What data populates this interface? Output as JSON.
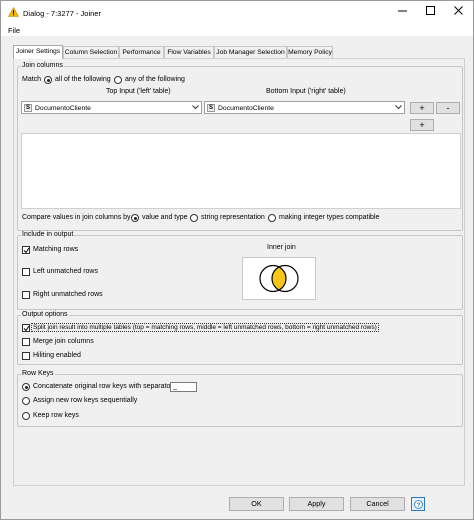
{
  "window": {
    "title": "Dialog - 7:3277 - Joiner",
    "controls": [
      "minimize-icon",
      "maximize-icon",
      "close-icon"
    ]
  },
  "menu": {
    "file": "File"
  },
  "tabs": [
    {
      "label": "Joiner Settings",
      "active": true
    },
    {
      "label": "Column Selection"
    },
    {
      "label": "Performance"
    },
    {
      "label": "Flow Variables"
    },
    {
      "label": "Job Manager Selection"
    },
    {
      "label": "Memory Policy"
    }
  ],
  "join_columns": {
    "title": "Join columns",
    "match_label": "Match",
    "match_all": "all of the following",
    "match_any": "any of the following",
    "match_selected": "all",
    "left_header": "Top Input ('left' table)",
    "right_header": "Bottom Input ('right' table)",
    "left_column": "DocumentoCliente",
    "right_column": "DocumentoCliente",
    "column_type_badge": "S",
    "add_label": "+",
    "remove_label": "-"
  },
  "compare": {
    "label": "Compare values in join columns by",
    "opt_value_type": "value and type",
    "opt_string": "string representation",
    "opt_integer": "making integer types compatible",
    "selected": "value and type"
  },
  "include_output": {
    "title": "Include in output",
    "matching_rows": "Matching rows",
    "left_unmatched": "Left unmatched rows",
    "right_unmatched": "Right unmatched rows",
    "matching_checked": true,
    "left_checked": false,
    "right_checked": false,
    "venn_title": "Inner join",
    "venn_fill_color": "#f5c518"
  },
  "output_options": {
    "title": "Output options",
    "split": "Split join result into multiple tables (top = matching rows, middle = left unmatched rows, bottom = right unmatched rows)",
    "merge": "Merge join columns",
    "hilite": "Hiliting enabled",
    "split_checked": true,
    "merge_checked": false,
    "hilite_checked": false
  },
  "row_keys": {
    "title": "Row Keys",
    "concat": "Concatenate original row keys with separator",
    "separator_value": "_",
    "assign": "Assign new row keys sequentially",
    "keep": "Keep row keys",
    "selected": "concat"
  },
  "buttons": {
    "ok": "OK",
    "apply": "Apply",
    "cancel": "Cancel"
  },
  "colors": {
    "warning": "#f2b705",
    "help_border": "#2b78c5"
  }
}
